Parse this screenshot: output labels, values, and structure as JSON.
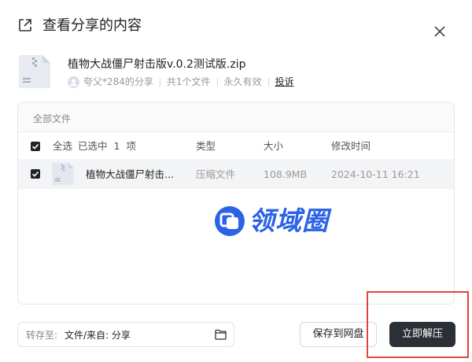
{
  "dialog": {
    "title": "查看分享的内容"
  },
  "file": {
    "name": "植物大战僵尸射击版v.0.2测试版.zip",
    "sharer": "夸父*284的分享",
    "count": "共1个文件",
    "validity": "永久有效",
    "report_label": "投诉"
  },
  "list": {
    "breadcrumb": "全部文件",
    "select_all_label": "全选",
    "selected_text": "已选中  1  项",
    "columns": {
      "type": "类型",
      "size": "大小",
      "modified": "修改时间"
    },
    "rows": [
      {
        "name": "植物大战僵尸射击...",
        "type": "压缩文件",
        "size": "108.9MB",
        "modified": "2024-10-11 16:21"
      }
    ]
  },
  "watermark": {
    "text": "领域圈",
    "color": "#2a62e8"
  },
  "footer": {
    "save_to_label": "转存至:",
    "save_to_path": "文件/来自: 分享",
    "save_button": "保存到网盘",
    "extract_button": "立即解压"
  },
  "colors": {
    "primary_button": "#2b2f36",
    "highlight": "#e0453a",
    "row_bg": "#f3f4f6"
  },
  "icons": {
    "title": "share-external-icon",
    "close": "close-icon",
    "file": "zip-file-icon",
    "folder": "folder-icon"
  }
}
